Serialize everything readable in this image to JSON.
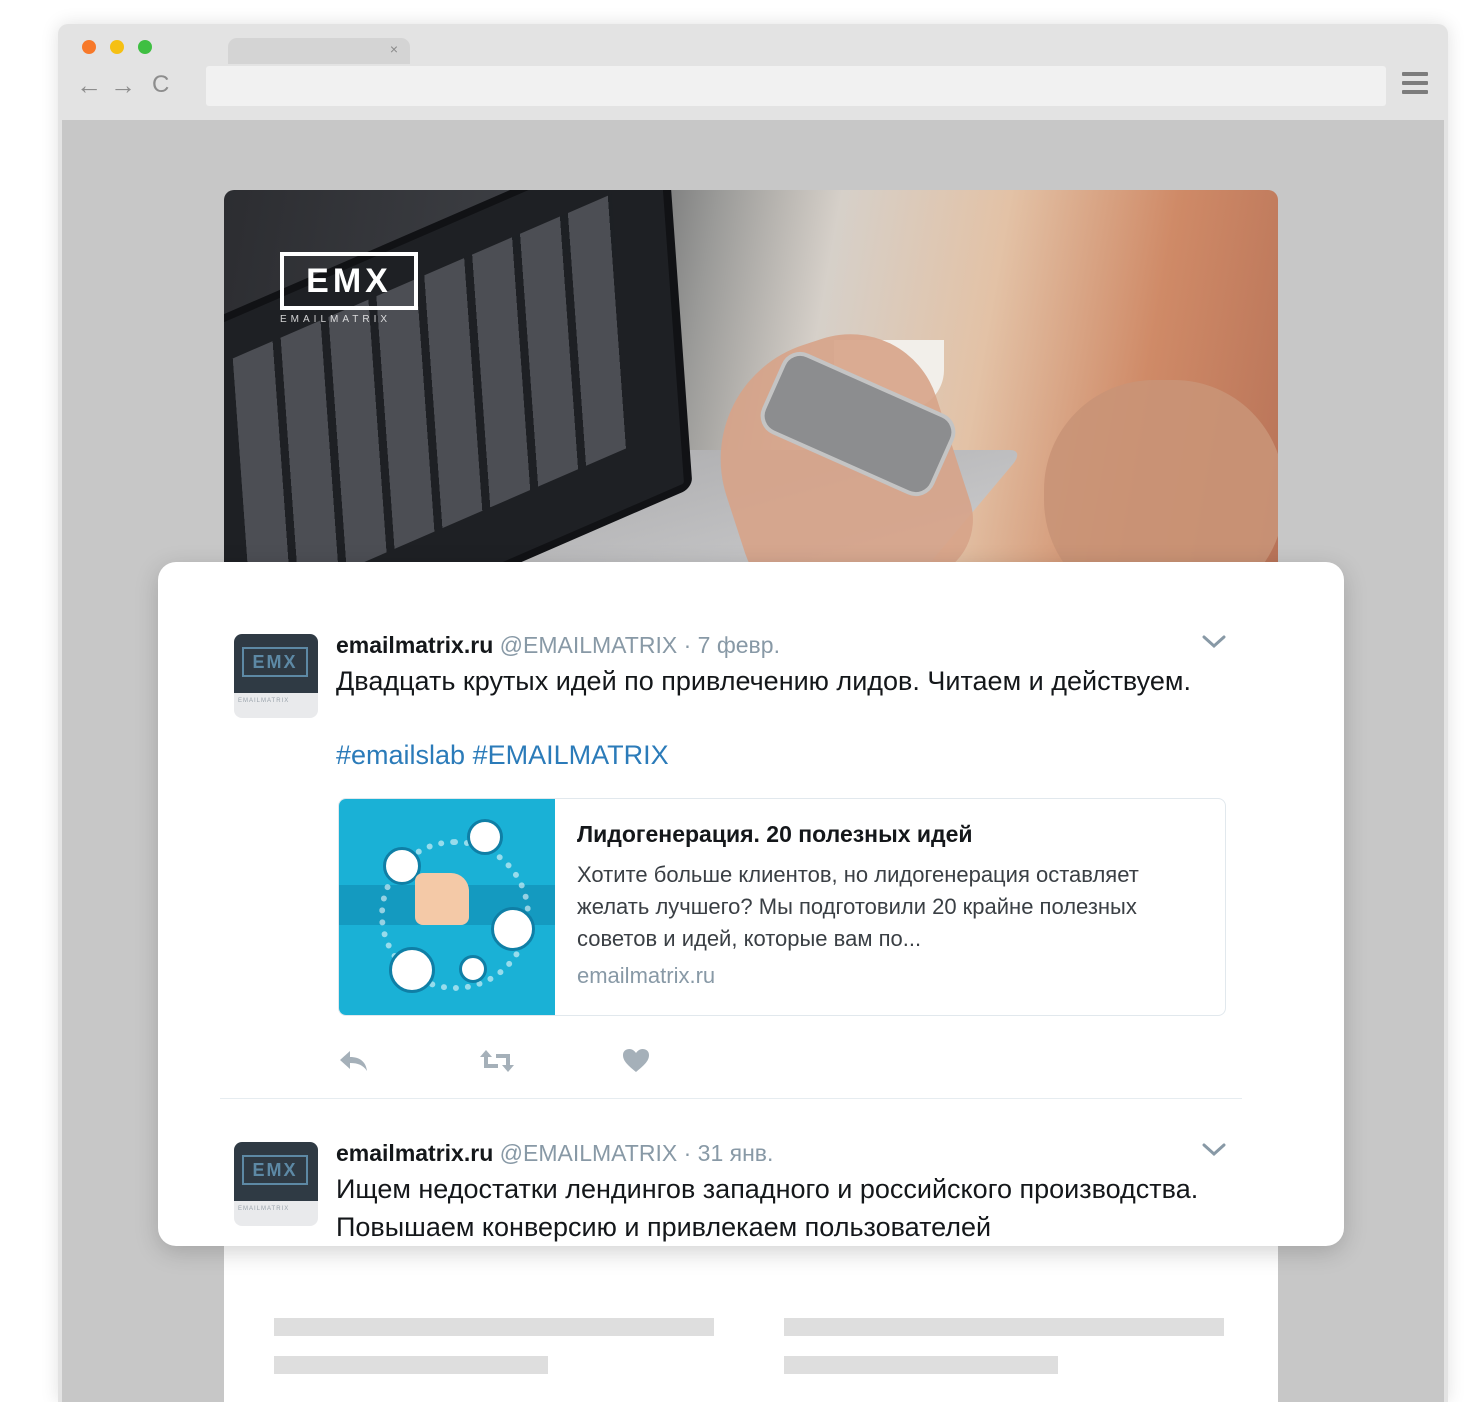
{
  "browser": {
    "tab": {
      "close_glyph": "×"
    },
    "nav": {
      "back": "←",
      "forward": "→",
      "reload": "C"
    },
    "icons": [
      "back-arrow-icon",
      "forward-arrow-icon",
      "reload-icon",
      "hamburger-menu-icon",
      "tab-close-icon"
    ]
  },
  "hero": {
    "logo_text": "EMX",
    "logo_sub": "EMAILMATRIX"
  },
  "tweets": [
    {
      "name": "emailmatrix.ru",
      "handle": "@EMAILMATRIX",
      "sep": "·",
      "date": "7 февр.",
      "text": "Двадцать крутых идей по привлечению лидов. Читаем и действуем.",
      "hashtags": "#emailslab #EMAILMATRIX",
      "avatar_text": "EMX",
      "avatar_sub": "EMAILMATRIX",
      "card": {
        "title": "Лидогенерация. 20 полезных идей",
        "description": "Хотите больше клиентов, но лидогенерация оставляет желать лучшего? Мы подготовили 20 крайне полезных советов и идей, которые вам по...",
        "domain": "emailmatrix.ru"
      },
      "actions": [
        "reply-icon",
        "retweet-icon",
        "like-icon"
      ]
    },
    {
      "name": "emailmatrix.ru",
      "handle": "@EMAILMATRIX",
      "sep": "·",
      "date": "31 янв.",
      "text": "Ищем недостатки лендингов западного и российского производства. Повышаем конверсию и привлекаем пользователей",
      "avatar_text": "EMX",
      "avatar_sub": "EMAILMATRIX"
    }
  ],
  "colors": {
    "window_frame": "#e3e3e3",
    "viewport_bg": "#c7c7c7",
    "hashtag": "#2b7bb9",
    "muted": "#8899a6",
    "card_image_bg": "#1ab1d6"
  }
}
